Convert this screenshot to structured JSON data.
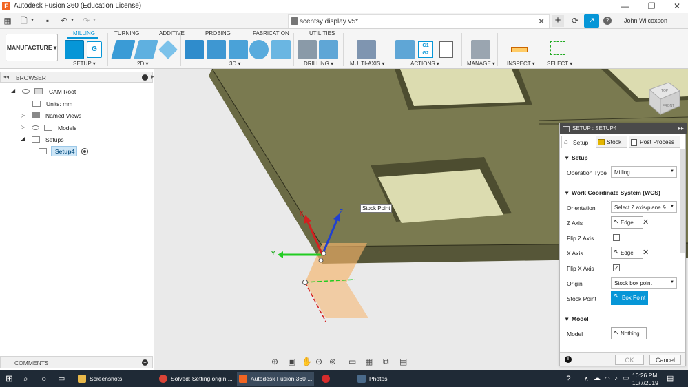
{
  "window": {
    "title": "Autodesk Fusion 360 (Education License)",
    "controls": [
      "—",
      "❐",
      "✕"
    ]
  },
  "doc": {
    "tab_title": "scentsy display v5*",
    "user_name": "John Wilcoxson"
  },
  "ribbon": {
    "workspace": "MANUFACTURE",
    "tabs": [
      "MILLING",
      "TURNING",
      "ADDITIVE",
      "PROBING",
      "FABRICATION",
      "UTILITIES"
    ],
    "active_tab": "MILLING",
    "groups": [
      "SETUP ▾",
      "2D ▾",
      "3D ▾",
      "DRILLING ▾",
      "MULTI-AXIS ▾",
      "ACTIONS ▾",
      "MANAGE ▾",
      "INSPECT ▾",
      "SELECT ▾"
    ],
    "g1g2_label": "G1 G2"
  },
  "browser": {
    "title": "BROWSER",
    "items": [
      "CAM Root",
      "Units: mm",
      "Named Views",
      "Models",
      "Setups",
      "Setup4"
    ]
  },
  "viewport": {
    "tooltip": "Stock Point",
    "axis_x": "X",
    "axis_y": "Y",
    "axis_z": "Z",
    "viewcube_top": "TOP",
    "viewcube_front": "FRONT"
  },
  "dialog": {
    "title": "SETUP : SETUP4",
    "tabs": [
      "Setup",
      "Stock",
      "Post Process"
    ],
    "setup_section": "Setup",
    "operation_type_label": "Operation Type",
    "operation_type_value": "Milling",
    "wcs_section": "Work Coordinate System (WCS)",
    "orientation_label": "Orientation",
    "orientation_value": "Select Z axis/plane & ...",
    "z_axis_label": "Z Axis",
    "z_axis_value": "Edge",
    "flip_z_label": "Flip Z Axis",
    "flip_z_checked": false,
    "x_axis_label": "X Axis",
    "x_axis_value": "Edge",
    "flip_x_label": "Flip X Axis",
    "flip_x_checked": true,
    "origin_label": "Origin",
    "origin_value": "Stock box point",
    "stock_point_label": "Stock Point",
    "stock_point_value": "Box Point",
    "model_section": "Model",
    "model_label": "Model",
    "model_value": "Nothing",
    "ok_label": "OK",
    "cancel_label": "Cancel"
  },
  "comments": {
    "label": "COMMENTS"
  },
  "taskbar": {
    "apps": [
      "Screenshots",
      "Solved: Setting origin ...",
      "Autodesk Fusion 360 ...",
      "Photos"
    ],
    "time": "10:26 PM",
    "date": "10/7/2019"
  },
  "colors": {
    "accent": "#0696d7",
    "stock_surface": "#7a7a50",
    "pocket": "#dcdcb0",
    "fusion_orange": "#f26522",
    "taskbar": "#1f2a36"
  }
}
